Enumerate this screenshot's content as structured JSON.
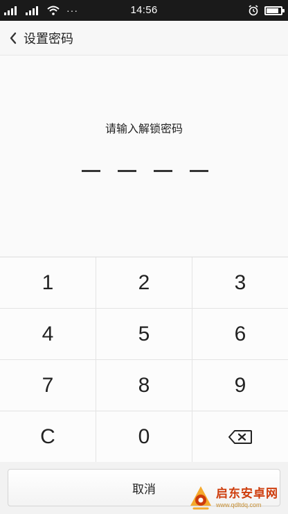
{
  "status_bar": {
    "signal1_label": "",
    "signal2_label": "",
    "more": "···",
    "time": "14:56",
    "battery_level": 0.85
  },
  "header": {
    "back_icon": "chevron-left-icon",
    "title": "设置密码"
  },
  "pin_entry": {
    "prompt": "请输入解锁密码",
    "slots": 4,
    "filled": 0
  },
  "keypad": {
    "keys": [
      "1",
      "2",
      "3",
      "4",
      "5",
      "6",
      "7",
      "8",
      "9",
      "C",
      "0",
      "⌫"
    ]
  },
  "cancel_label": "取消",
  "watermark": {
    "name": "启东安卓网",
    "url": "www.qdltdq.com"
  },
  "colors": {
    "status_bar_bg": "#1a1a1a",
    "watermark_red": "#cc3300"
  }
}
